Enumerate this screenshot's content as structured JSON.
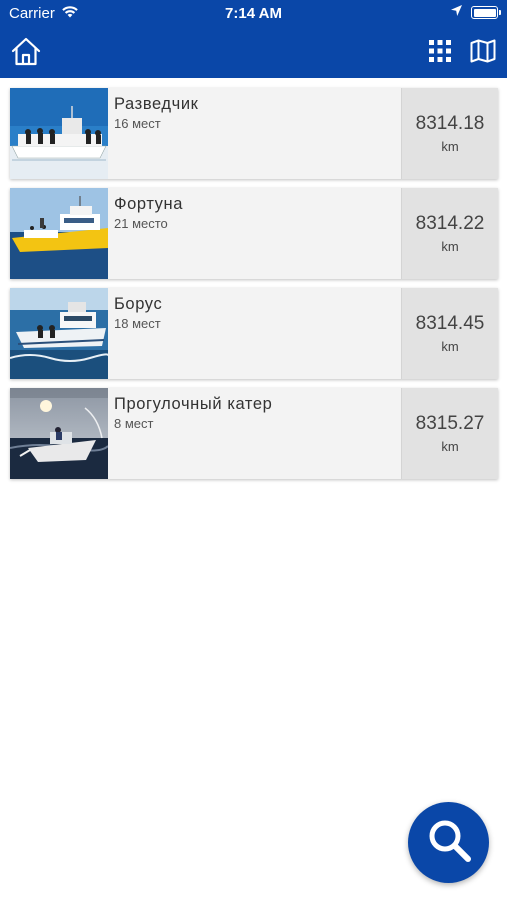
{
  "status_bar": {
    "carrier": "Carrier",
    "time": "7:14 AM",
    "wifi_icon": "wifi-icon",
    "location_icon": "location-arrow-icon",
    "battery_icon": "battery-icon"
  },
  "nav": {
    "home_icon": "home-icon",
    "grid_icon": "grid-icon",
    "map_icon": "map-icon"
  },
  "boats": [
    {
      "name": "Разведчик",
      "seats": "16 мест",
      "distance": "8314.18",
      "unit": "km"
    },
    {
      "name": "Фортуна",
      "seats": "21 место",
      "distance": "8314.22",
      "unit": "km"
    },
    {
      "name": "Борус",
      "seats": "18 мест",
      "distance": "8314.45",
      "unit": "km"
    },
    {
      "name": "Прогулочный катер",
      "seats": "8 мест",
      "distance": "8315.27",
      "unit": "km"
    }
  ],
  "fab": {
    "icon": "search-icon"
  },
  "colors": {
    "brand": "#0a47a8",
    "card_bg": "#f3f3f3",
    "distance_bg": "#e2e2e2",
    "background": "#ffffff"
  }
}
